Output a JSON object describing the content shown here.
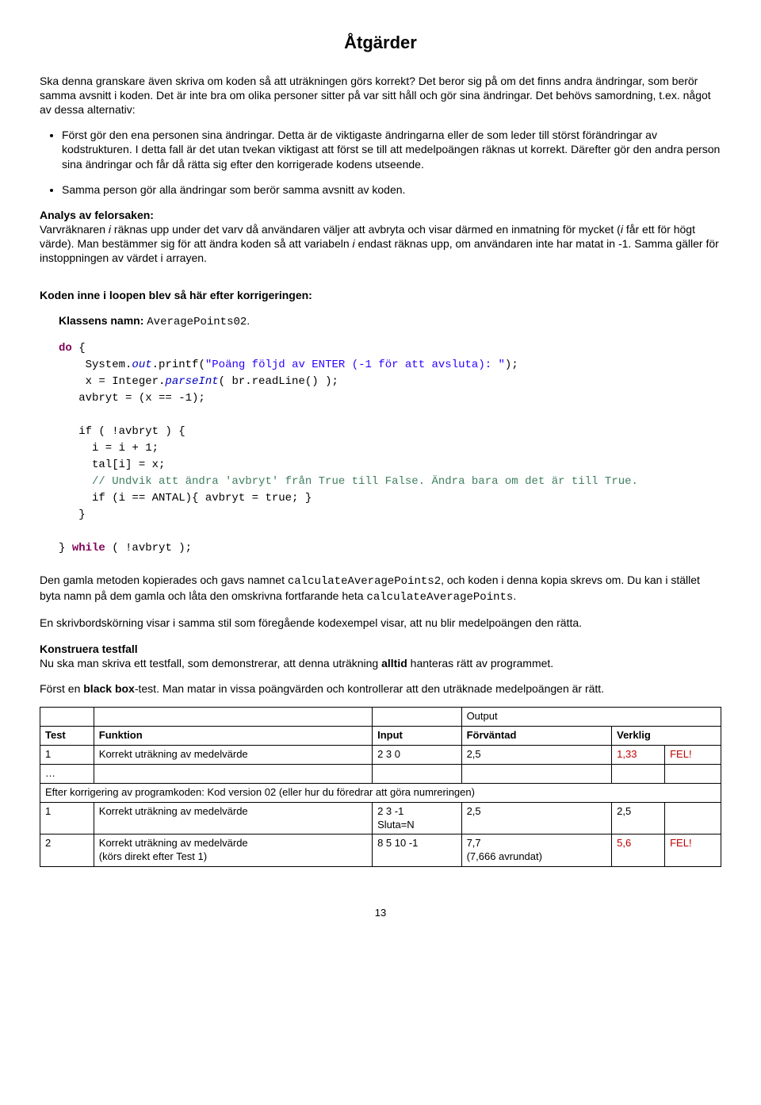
{
  "title": "Åtgärder",
  "p1": "Ska denna granskare även skriva om koden så att uträkningen görs korrekt? Det beror sig på om det finns andra ändringar, som berör samma avsnitt i koden. Det är inte bra om olika personer sitter på var sitt håll och gör sina ändringar. Det behövs samordning, t.ex. något av dessa alternativ:",
  "bullet1": "Först gör den ena personen sina ändringar. Detta är de viktigaste ändringarna eller de som leder till störst förändringar av kodstrukturen. I detta fall är det utan tvekan viktigast att först se till att medelpoängen räknas ut korrekt. Därefter gör den andra person sina ändringar och får då rätta sig efter den korrigerade kodens utseende.",
  "bullet2": "Samma person gör alla ändringar som berör samma avsnitt av koden.",
  "analys_h": "Analys av felorsaken:",
  "analys_pre": "Varvräknaren ",
  "analys_i1": "i",
  "analys_mid1": " räknas upp under det varv då användaren väljer att avbryta och visar därmed en inmatning för mycket (",
  "analys_i2": "i",
  "analys_mid2": " får ett för högt värde). Man bestämmer sig för att ändra koden så att variabeln ",
  "analys_i3": "i",
  "analys_mid3": " endast räknas upp, om användaren inte har matat in -1. Samma gäller för instoppningen av värdet i arrayen.",
  "loop_h": "Koden inne i loopen blev så här efter korrigeringen:",
  "class_label": "Klassens namn: ",
  "class_name": "AveragePoints02",
  "code": {
    "do": "do",
    "lbrace": " {",
    "system": "    System.",
    "out": "out",
    "printf": ".printf(",
    "str1": "\"Poäng följd av ENTER (-1 för att avsluta): \"",
    "closeprint": ");",
    "xint": "    x = Integer.",
    "parseInt": "parseInt",
    "brread": "( br.readLine() );",
    "avbryt": "   avbryt = (x == -1);",
    "ifline": "   if ( !avbryt ) {",
    "inc": "     i = i + 1;",
    "tali": "     tal[i] = x;",
    "comment": "     // Undvik att ändra 'avbryt' från True till False. Ändra bara om det är till True.",
    "ifantal": "     if (i == ANTAL){ avbryt = true; }",
    "closeif": "   }",
    "closedo": "} ",
    "while": "while",
    "whilecond": " ( !avbryt );"
  },
  "p2_pre": "Den gamla metoden kopierades och gavs namnet ",
  "p2_code1": "calculateAveragePoints2",
  "p2_mid": ", och koden i denna kopia skrevs om. Du kan i stället byta namn på dem gamla och låta den omskrivna fortfarande heta ",
  "p2_code2": "calculateAveragePoints",
  "p2_end": ".",
  "p3": "En skrivbordskörning visar i samma stil som föregående kodexempel visar, att nu blir medelpoängen den rätta.",
  "konstr_h": "Konstruera testfall",
  "konstr_p_pre": "Nu ska man skriva ett testfall, som demonstrerar, att denna uträkning ",
  "konstr_alltid": "alltid",
  "konstr_p_post": " hanteras rätt av programmet.",
  "blackbox_pre": "Först en ",
  "blackbox_b": "black box",
  "blackbox_post": "-test. Man matar in vissa poängvärden och kontrollerar att den uträknade medelpoängen är rätt.",
  "table": {
    "output": "Output",
    "h_test": "Test",
    "h_funk": "Funktion",
    "h_input": "Input",
    "h_forv": "Förväntad",
    "h_verk": "Verklig",
    "r1": {
      "n": "1",
      "f": "Korrekt uträkning av medelvärde",
      "i": "2 3 0",
      "fv": "2,5",
      "v": "1,33",
      "fel": "FEL!"
    },
    "dots": "…",
    "after": "Efter korrigering av programkoden: Kod version 02 (eller hur du föredrar att göra numreringen)",
    "r2": {
      "n": "1",
      "f": "Korrekt uträkning av medelvärde",
      "i1": "2 3 -1",
      "i2": "Sluta=N",
      "fv": "2,5",
      "v": "2,5"
    },
    "r3": {
      "n": "2",
      "f1": "Korrekt uträkning av medelvärde",
      "f2": "(körs direkt efter Test 1)",
      "i": "8 5 10 -1",
      "fv1": "7,7",
      "fv2": "(7,666 avrundat)",
      "v": "5,6",
      "fel": "FEL!"
    }
  },
  "pagenum": "13"
}
